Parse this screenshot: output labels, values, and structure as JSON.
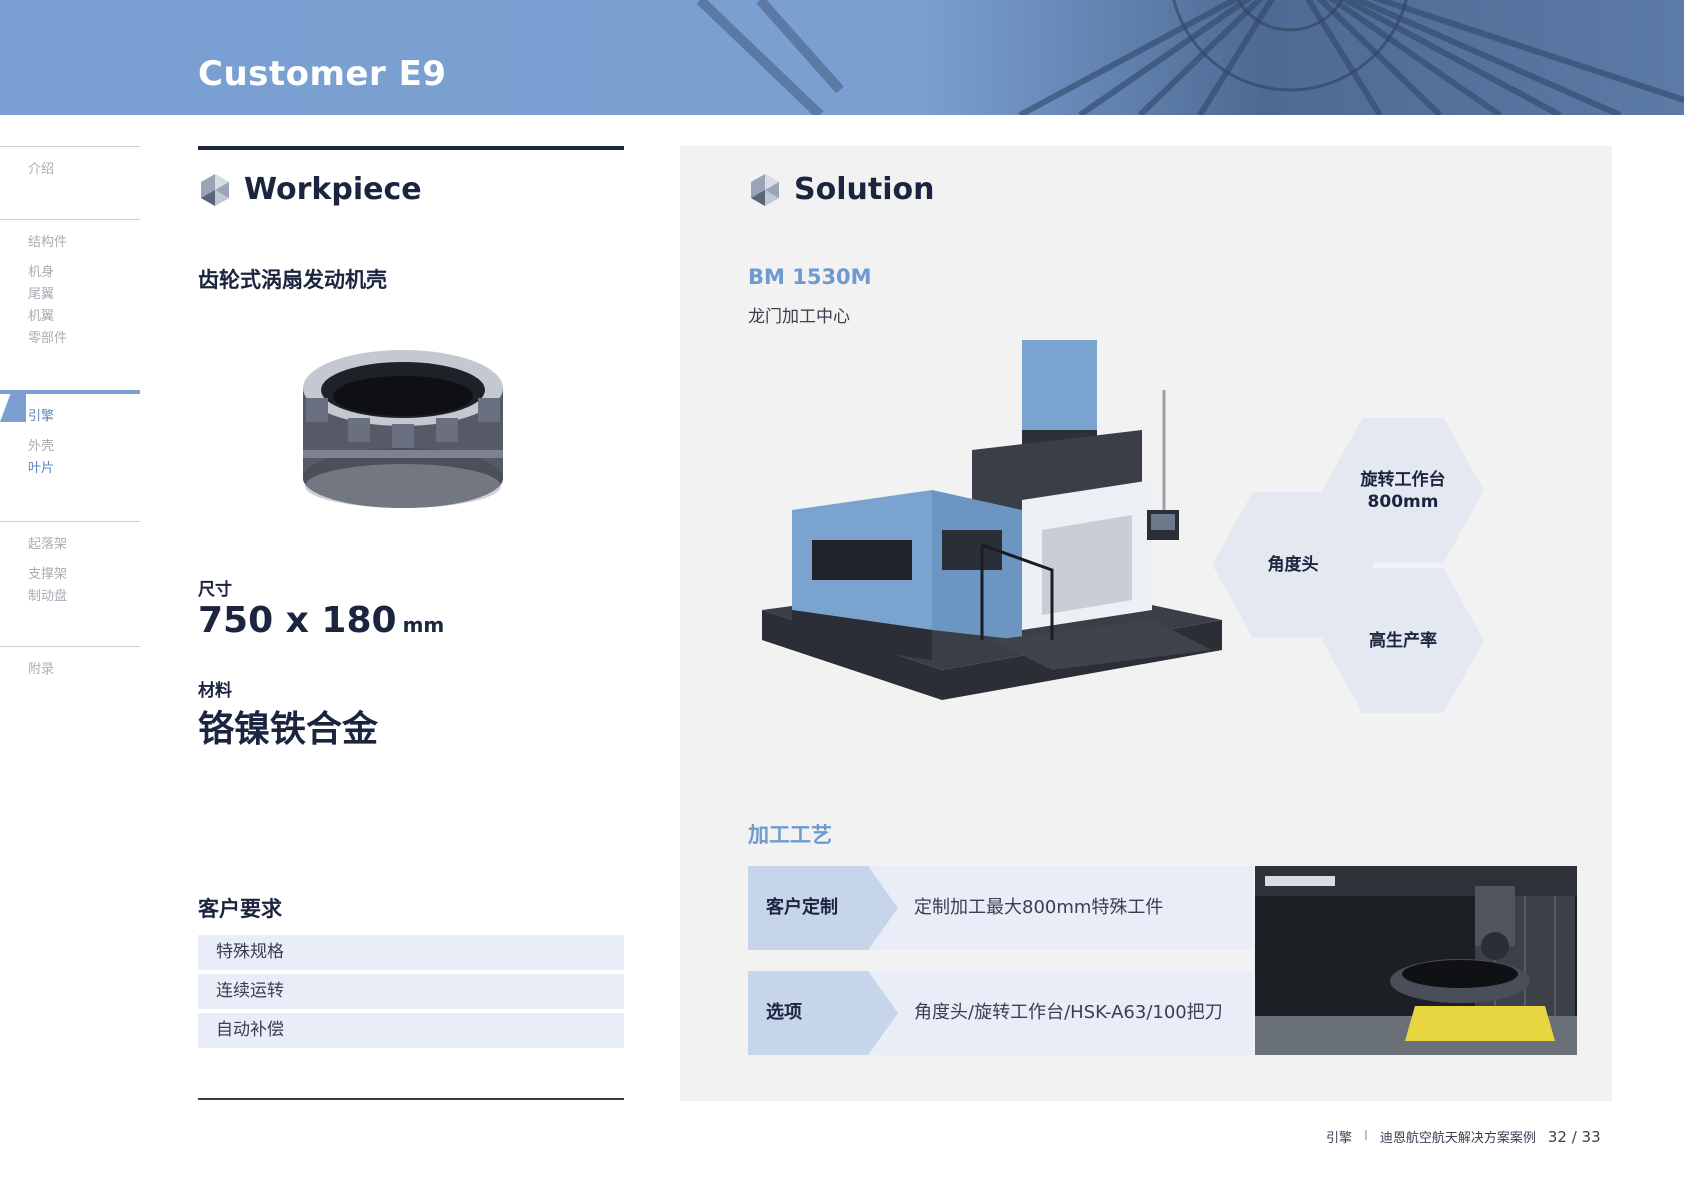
{
  "header": {
    "title": "Customer E9"
  },
  "sidebar": {
    "sections": [
      {
        "head": "介绍",
        "items": []
      },
      {
        "head": "结构件",
        "items": [
          "机身",
          "尾翼",
          "机翼",
          "零部件"
        ]
      },
      {
        "head": "引擎",
        "items": [
          "外壳",
          "叶片"
        ]
      },
      {
        "head": "起落架",
        "items": [
          "支撑架",
          "制动盘"
        ]
      },
      {
        "head": "附录",
        "items": []
      }
    ]
  },
  "workpiece": {
    "title": "Workpiece",
    "name": "齿轮式涡扇发动机壳",
    "size_label": "尺寸",
    "size_value": "750 x 180",
    "size_unit": "mm",
    "material_label": "材料",
    "material_value": "铬镍铁合金",
    "requirements_title": "客户要求",
    "requirements": [
      "特殊规格",
      "连续运转",
      "自动补偿"
    ]
  },
  "solution": {
    "title": "Solution",
    "model": "BM 1530M",
    "model_sub": "龙门加工中心",
    "features": {
      "rotary_table_line1": "旋转工作台",
      "rotary_table_line2": "800mm",
      "angle_head": "角度头",
      "productivity": "高生产率"
    },
    "process_title": "加工工艺",
    "process": [
      {
        "key": "客户定制",
        "value": "定制加工最大800mm特殊工件"
      },
      {
        "key": "选项",
        "value": "角度头/旋转工作台/HSK-A63/100把刀"
      }
    ]
  },
  "footer": {
    "section": "引擎",
    "separator": "I",
    "doc": "迪恩航空航天解决方案案例",
    "page": "32 / 33"
  },
  "colors": {
    "accent": "#7a9fd0",
    "dark": "#1c2540",
    "panel": "#f2f2f2"
  }
}
